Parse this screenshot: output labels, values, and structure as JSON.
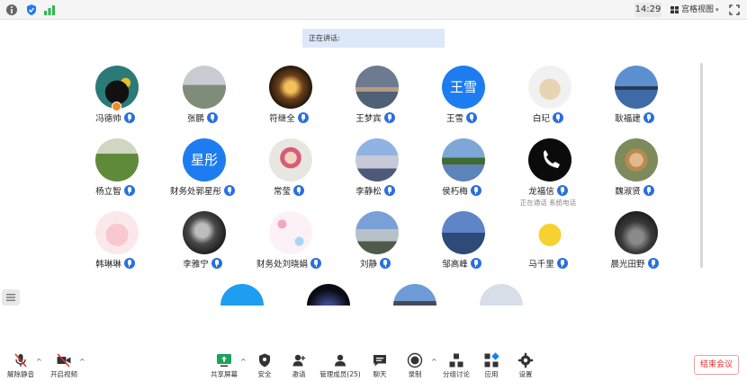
{
  "topbar": {
    "time": "14:29",
    "view_label": "宫格视图",
    "view_caret": "▾",
    "icons": [
      "info-icon",
      "shield-icon",
      "signal-icon"
    ]
  },
  "speaking": {
    "label": "正在讲话:"
  },
  "participants": [
    {
      "name": "冯德帅",
      "row": 0,
      "col": 0,
      "avatar": "photo-black-cat",
      "badge": true
    },
    {
      "name": "张鹏",
      "row": 0,
      "col": 1,
      "avatar": "photo-person-road"
    },
    {
      "name": "符继全",
      "row": 0,
      "col": 2,
      "avatar": "photo-lights"
    },
    {
      "name": "王梦宾",
      "row": 0,
      "col": 3,
      "avatar": "photo-sky-sea"
    },
    {
      "name": "王雪",
      "row": 0,
      "col": 4,
      "avatar_text": "王雪"
    },
    {
      "name": "白玘",
      "row": 0,
      "col": 5,
      "avatar": "photo-cartoon-cat"
    },
    {
      "name": "耿福建",
      "row": 0,
      "col": 6,
      "avatar": "photo-city-lake"
    },
    {
      "name": "杨立智",
      "row": 1,
      "col": 0,
      "avatar": "photo-kid-grass"
    },
    {
      "name": "财务处郭星彤",
      "row": 1,
      "col": 1,
      "avatar_text": "星彤"
    },
    {
      "name": "常莹",
      "row": 1,
      "col": 2,
      "avatar": "photo-girl"
    },
    {
      "name": "李静松",
      "row": 1,
      "col": 3,
      "avatar": "photo-castle"
    },
    {
      "name": "侯朽梅",
      "row": 1,
      "col": 4,
      "avatar": "photo-lake-trees"
    },
    {
      "name": "龙福信",
      "row": 1,
      "col": 5,
      "avatar": "phone-icon-avatar",
      "sub": "正在通话 系统电话"
    },
    {
      "name": "魏淑贤",
      "row": 1,
      "col": 6,
      "avatar": "photo-person-hat"
    },
    {
      "name": "韩琳琳",
      "row": 2,
      "col": 0,
      "avatar": "photo-pink-cartoon"
    },
    {
      "name": "李雅宁",
      "row": 2,
      "col": 1,
      "avatar": "photo-bw-girl"
    },
    {
      "name": "财务处刘晓娟",
      "row": 2,
      "col": 2,
      "avatar": "photo-fine-flowers"
    },
    {
      "name": "刘静",
      "row": 2,
      "col": 3,
      "avatar": "photo-street"
    },
    {
      "name": "邹高峰",
      "row": 2,
      "col": 4,
      "avatar": "photo-harbor"
    },
    {
      "name": "马千里",
      "row": 2,
      "col": 5,
      "avatar": "photo-pikachu"
    },
    {
      "name": "晨光田野",
      "row": 2,
      "col": 6,
      "avatar": "photo-bw-trees"
    }
  ],
  "toolbar": {
    "mute_label": "解除静音",
    "video_label": "开启视频",
    "share_label": "共享屏幕",
    "security_label": "安全",
    "invite_label": "邀请",
    "members_label": "管理成员(25)",
    "chat_label": "聊天",
    "record_label": "录制",
    "breakout_label": "分组讨论",
    "apps_label": "应用",
    "settings_label": "设置",
    "end_label": "结束会议",
    "caret": "^"
  },
  "colors": {
    "accent": "#1d7df0",
    "end_red": "#e0312f",
    "share_green": "#1aa35b"
  }
}
